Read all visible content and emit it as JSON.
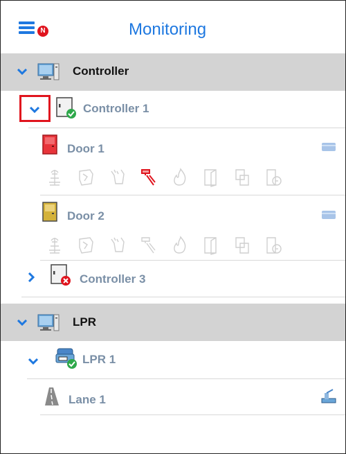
{
  "header": {
    "title": "Monitoring",
    "badge": "N"
  },
  "groups": [
    {
      "label": "Controller"
    },
    {
      "label": "LPR"
    }
  ],
  "controllers": [
    {
      "label": "Controller 1",
      "status": "online"
    },
    {
      "label": "Controller 3",
      "status": "offline"
    }
  ],
  "doors": [
    {
      "label": "Door 1",
      "color": "#e8343a"
    },
    {
      "label": "Door 2",
      "color": "#d4b23a"
    }
  ],
  "lpr": {
    "device": "LPR 1",
    "lane": "Lane 1"
  },
  "event_icons": [
    "antenna-icon",
    "broken-icon",
    "hand-icon",
    "hammer-icon",
    "fire-icon",
    "door-open-icon",
    "double-icon",
    "clock-icon"
  ],
  "colors": {
    "accent": "#1e78e0",
    "alarm": "#e0141e",
    "online": "#2ea84a",
    "muted": "#7a8fa6",
    "event_inactive": "#c8c8c8"
  }
}
